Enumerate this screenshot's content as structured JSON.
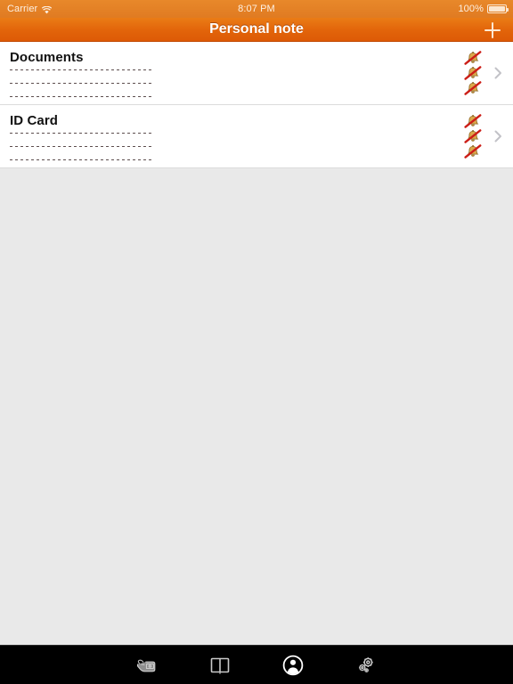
{
  "status_bar": {
    "carrier": "Carrier",
    "wifi_icon": "wifi-icon",
    "time": "8:07 PM",
    "battery_percent": "100%",
    "battery_icon": "battery-full-icon"
  },
  "nav_bar": {
    "title": "Personal note",
    "add_button_icon": "plus-icon",
    "add_button_label": "+"
  },
  "colors": {
    "nav_gradient_top": "#ea7c16",
    "nav_gradient_bottom": "#dd5a06",
    "status_bar": "#e07b22",
    "page_background": "#e9e9e9",
    "row_background": "#ffffff",
    "separator": "#dcdcdc",
    "title_text": "#111111",
    "dash_line": "#5d4e4e",
    "chevron": "#c7c7cc",
    "tab_bar": "#000000",
    "bell_body": "#d9a441",
    "bell_slash": "#cc1e17"
  },
  "list": {
    "rows": [
      {
        "title": "Documents",
        "dash_lines": 3,
        "badges": [
          "bell-slash-icon",
          "bell-slash-icon",
          "bell-slash-icon"
        ],
        "disclosure_icon": "chevron-right-icon"
      },
      {
        "title": "ID Card",
        "dash_lines": 3,
        "badges": [
          "bell-slash-icon",
          "bell-slash-icon",
          "bell-slash-icon"
        ],
        "disclosure_icon": "chevron-right-icon"
      }
    ]
  },
  "tab_bar": {
    "tabs": [
      {
        "name": "tab-money",
        "icon": "hand-money-icon",
        "active": false
      },
      {
        "name": "tab-book",
        "icon": "open-book-icon",
        "active": false
      },
      {
        "name": "tab-profile",
        "icon": "person-circle-icon",
        "active": true
      },
      {
        "name": "tab-settings",
        "icon": "gears-icon",
        "active": false
      }
    ]
  }
}
